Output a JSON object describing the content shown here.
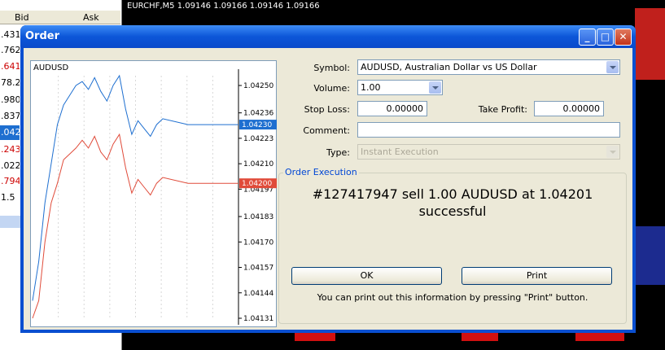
{
  "market_watch": {
    "col_bid": "Bid",
    "col_ask": "Ask",
    "rows": [
      ".431",
      ".762",
      ".641",
      "78.2",
      ".980",
      ".837",
      ".042",
      ".243",
      ".022",
      ".794",
      "1.5"
    ]
  },
  "background_chart": {
    "title": "EURCHF,M5  1.09146 1.09166 1.09146 1.09166"
  },
  "dialog": {
    "title": "Order",
    "minimize_icon": "minimize-icon",
    "maximize_icon": "maximize-icon",
    "close_icon": "close-icon"
  },
  "mini_chart": {
    "symbol": "AUDUSD",
    "y_ticks": [
      "1.04250",
      "1.04236",
      "1.04223",
      "1.04210",
      "1.04197",
      "1.04183",
      "1.04170",
      "1.04157",
      "1.04144",
      "1.04131"
    ],
    "ask_tag": "1.04230",
    "bid_tag": "1.04200",
    "ask_color": "#1e6fd0",
    "bid_color": "#e04b3a"
  },
  "chart_data": {
    "type": "line",
    "title": "AUDUSD",
    "ylim": [
      1.04131,
      1.04255
    ],
    "series": [
      {
        "values": [
          1.0414,
          1.0416,
          1.0419,
          1.0421,
          1.0423,
          1.0424,
          1.04245,
          1.0425,
          1.04252,
          1.04248,
          1.04254,
          1.04247,
          1.04242,
          1.0425,
          1.04255,
          1.04238,
          1.04225,
          1.04232,
          1.04228,
          1.04224,
          1.0423,
          1.04233,
          1.0423,
          1.0423,
          1.0423
        ]
      },
      {
        "values": [
          1.04131,
          1.0414,
          1.0417,
          1.0419,
          1.042,
          1.04212,
          1.04215,
          1.04218,
          1.04222,
          1.04218,
          1.04224,
          1.04216,
          1.04212,
          1.0422,
          1.04225,
          1.04208,
          1.04195,
          1.04202,
          1.04198,
          1.04194,
          1.042,
          1.04203,
          1.042,
          1.042,
          1.042
        ]
      }
    ]
  },
  "form": {
    "symbol_label": "Symbol:",
    "symbol_value": "AUDUSD, Australian Dollar vs US Dollar",
    "volume_label": "Volume:",
    "volume_value": "1.00",
    "stop_loss_label": "Stop Loss:",
    "stop_loss_value": "0.00000",
    "take_profit_label": "Take Profit:",
    "take_profit_value": "0.00000",
    "comment_label": "Comment:",
    "comment_value": "",
    "type_label": "Type:",
    "type_value": "Instant Execution"
  },
  "execution": {
    "legend": "Order Execution",
    "result_line1": "#127417947 sell 1.00 AUDUSD at 1.04201",
    "result_line2": "successful",
    "ok_label": "OK",
    "print_label": "Print",
    "hint": "You can print out this information by pressing \"Print\" button."
  }
}
